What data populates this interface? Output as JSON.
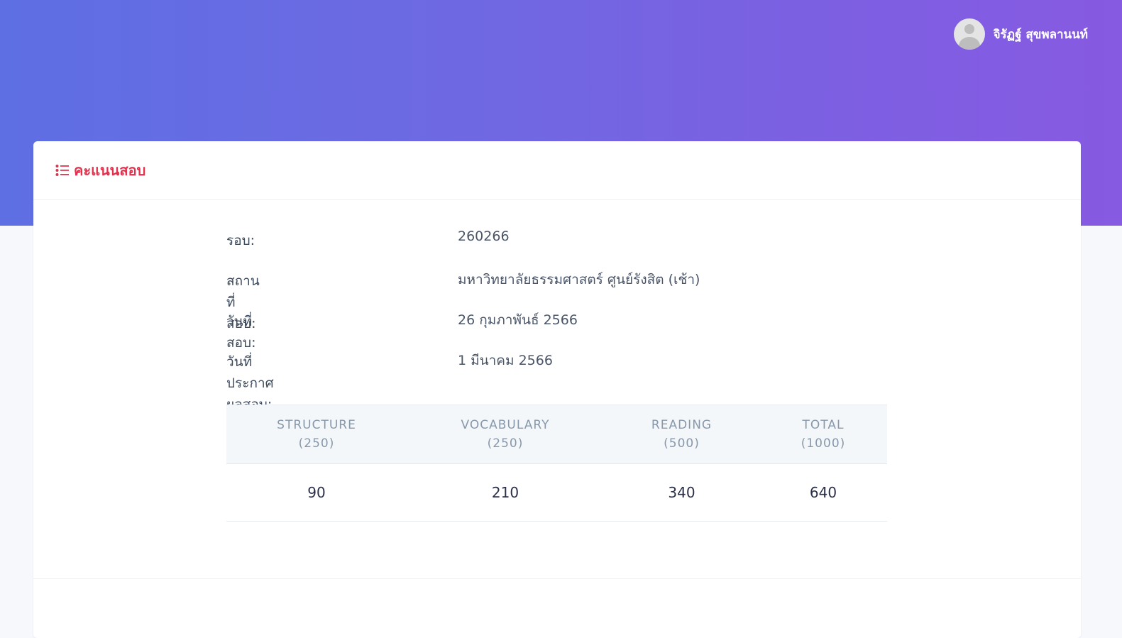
{
  "user": {
    "name": "จิรัฏฐ์ สุขพลานนท์"
  },
  "card": {
    "title": "คะแนนสอบ",
    "icon": "list-icon"
  },
  "info": [
    {
      "label": "รอบ:",
      "value": "260266"
    },
    {
      "label": "สถานที่สอบ:",
      "value": "มหาวิทยาลัยธรรมศาสตร์ ศูนย์รังสิต (เช้า)"
    },
    {
      "label": "วันที่สอบ:",
      "value": "26 กุมภาพันธ์ 2566"
    },
    {
      "label": "วันที่ประกาศผลสอบ:",
      "value": "1 มีนาคม 2566"
    }
  ],
  "scores": {
    "headers": [
      {
        "name": "STRUCTURE",
        "max": "(250)"
      },
      {
        "name": "VOCABULARY",
        "max": "(250)"
      },
      {
        "name": "READING",
        "max": "(500)"
      },
      {
        "name": "TOTAL",
        "max": "(1000)"
      }
    ],
    "values": [
      "90",
      "210",
      "340",
      "640"
    ]
  },
  "colors": {
    "accent": "#e3304d",
    "gradient_start": "#5e6fe3",
    "gradient_end": "#865ae1"
  }
}
